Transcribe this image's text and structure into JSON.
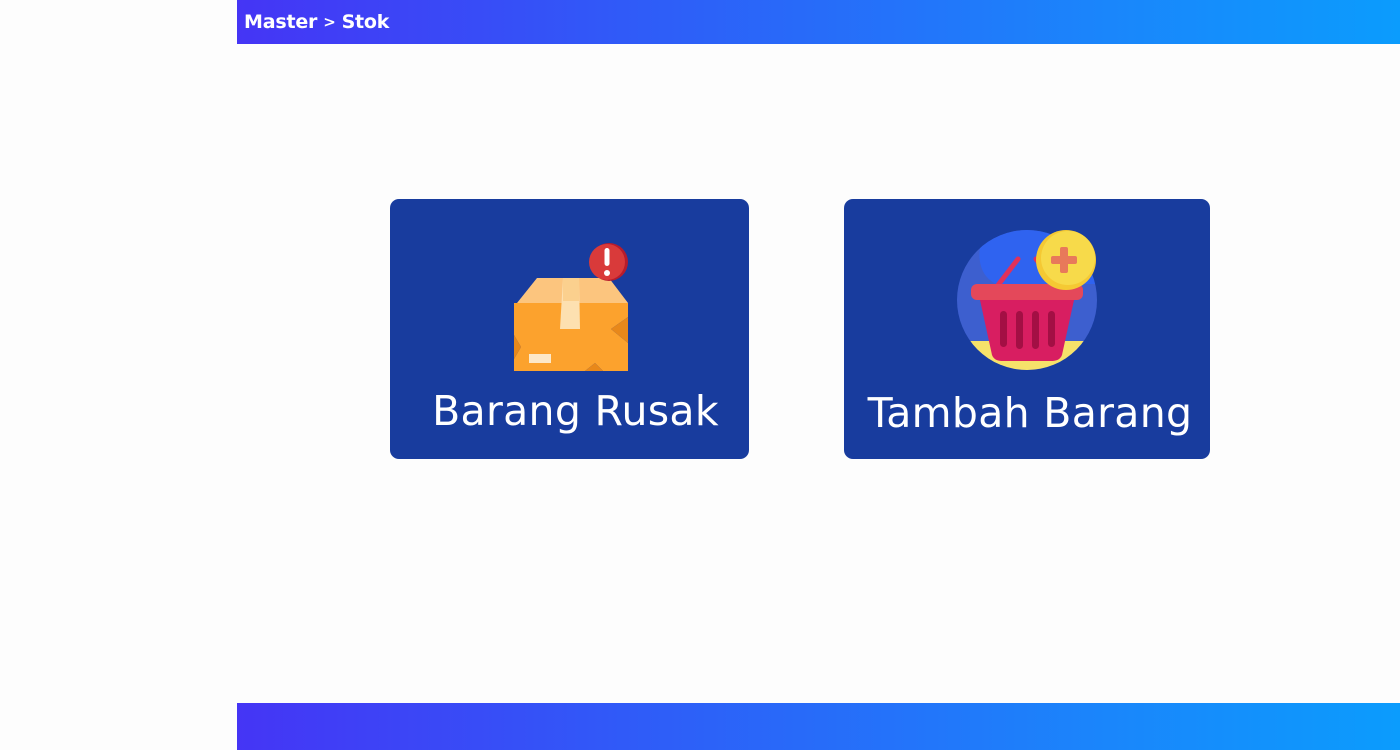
{
  "header": {
    "breadcrumb": [
      "Master",
      "Stok"
    ],
    "separator": ">"
  },
  "menu": {
    "cards": [
      {
        "label": "Barang Rusak",
        "icon": "damaged-box-icon"
      },
      {
        "label": "Tambah Barang",
        "icon": "add-basket-icon"
      }
    ]
  },
  "colors": {
    "header_gradient_start": "#4535f5",
    "header_gradient_end": "#0b9cfd",
    "card_background": "#183c9e",
    "card_text": "#ffffff"
  }
}
